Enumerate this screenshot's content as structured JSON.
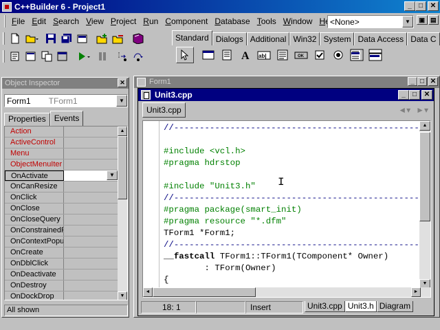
{
  "window": {
    "title": "C++Builder 6 - Project1"
  },
  "menu": {
    "items": [
      {
        "label": "File",
        "key": "F",
        "rest": "ile"
      },
      {
        "label": "Edit",
        "key": "E",
        "rest": "dit"
      },
      {
        "label": "Search",
        "key": "S",
        "rest": "earch"
      },
      {
        "label": "View",
        "key": "V",
        "rest": "iew"
      },
      {
        "label": "Project",
        "key": "P",
        "rest": "roject"
      },
      {
        "label": "Run",
        "key": "R",
        "rest": "un"
      },
      {
        "label": "Component",
        "key": "C",
        "rest": "omponent"
      },
      {
        "label": "Database",
        "key": "D",
        "rest": "atabase"
      },
      {
        "label": "Tools",
        "key": "T",
        "rest": "ools"
      },
      {
        "label": "Window",
        "key": "W",
        "rest": "indow"
      },
      {
        "label": "Help",
        "key": "H",
        "rest": "elp"
      }
    ]
  },
  "desktop_combo": {
    "value": "<None>"
  },
  "palette": {
    "tabs": [
      "Standard",
      "Dialogs",
      "Additional",
      "Win32",
      "System",
      "Data Access",
      "Data C"
    ],
    "active_tab": "Standard"
  },
  "object_inspector": {
    "title": "Object Inspector",
    "combo_object": "Form1",
    "combo_type": "TForm1",
    "tabs": [
      "Properties",
      "Events"
    ],
    "active_tab": "Events",
    "events": [
      {
        "name": "Action",
        "ref": true
      },
      {
        "name": "ActiveControl",
        "ref": true
      },
      {
        "name": "Menu",
        "ref": true
      },
      {
        "name": "ObjectMenuIter",
        "ref": true
      },
      {
        "name": "OnActivate",
        "ref": false,
        "selected": true
      },
      {
        "name": "OnCanResize",
        "ref": false
      },
      {
        "name": "OnClick",
        "ref": false
      },
      {
        "name": "OnClose",
        "ref": false
      },
      {
        "name": "OnCloseQuery",
        "ref": false
      },
      {
        "name": "OnConstrainedRe",
        "ref": false
      },
      {
        "name": "OnContextPopup",
        "ref": false
      },
      {
        "name": "OnCreate",
        "ref": false
      },
      {
        "name": "OnDblClick",
        "ref": false
      },
      {
        "name": "OnDeactivate",
        "ref": false
      },
      {
        "name": "OnDestroy",
        "ref": false
      },
      {
        "name": "OnDockDrop",
        "ref": false
      }
    ],
    "status": "All shown"
  },
  "form_window": {
    "title": "Form1"
  },
  "editor": {
    "title": "Unit3.cpp",
    "tab": "Unit3.cpp",
    "code_lines": [
      {
        "text": "//---------------------------------------------------------------",
        "style": "comment"
      },
      {
        "text": "",
        "style": "plain"
      },
      {
        "text": "#include <vcl.h>",
        "style": "pre"
      },
      {
        "text": "#pragma hdrstop",
        "style": "pre"
      },
      {
        "text": "",
        "style": "plain"
      },
      {
        "text": "#include \"Unit3.h\"",
        "style": "pre"
      },
      {
        "text": "//---------------------------------------------------------------",
        "style": "comment"
      },
      {
        "text": "#pragma package(smart_init)",
        "style": "pre"
      },
      {
        "text": "#pragma resource \"*.dfm\"",
        "style": "pre"
      },
      {
        "text": "TForm1 *Form1;",
        "style": "plain"
      },
      {
        "text": "//---------------------------------------------------------------",
        "style": "comment"
      },
      {
        "text": "__fastcall TForm1::TForm1(TComponent* Owner)",
        "style": "fastcall"
      },
      {
        "text": "        : TForm(Owner)",
        "style": "plain"
      },
      {
        "text": "{",
        "style": "plain"
      }
    ],
    "status": {
      "position": "18:  1",
      "modified": "",
      "mode": "Insert"
    },
    "file_tabs": [
      "Unit3.cpp",
      "Unit3.h",
      "Diagram"
    ],
    "active_file_tab": "Unit3.h"
  }
}
